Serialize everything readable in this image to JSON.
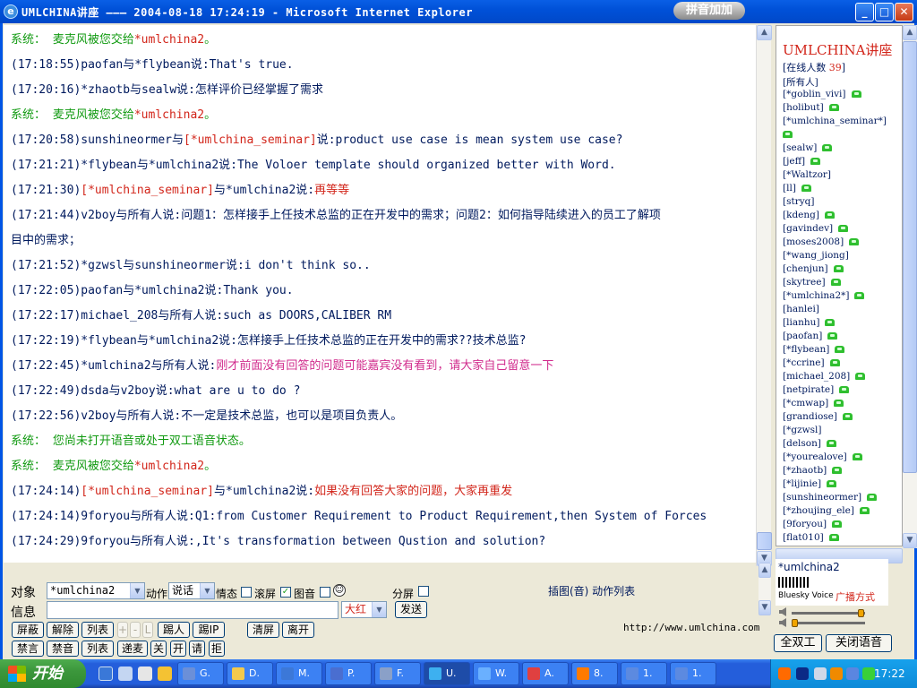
{
  "window": {
    "title": "UMLCHINA讲座 ——— 2004-08-18 17:24:19 - Microsoft Internet Explorer",
    "ime_badge": "拼音加加",
    "buttons": {
      "minimize": "_",
      "maximize": "□",
      "close": "✕"
    }
  },
  "chat": {
    "lines": [
      [
        {
          "t": "系统： ",
          "c": "green"
        },
        {
          "t": "麦克风被您交给",
          "c": "green"
        },
        {
          "t": "*umlchina2",
          "c": "red"
        },
        {
          "t": "。",
          "c": "green"
        }
      ],
      [
        {
          "t": "(17:18:55)paofan与*flybean说:That's true.",
          "c": "navy"
        }
      ],
      [
        {
          "t": "(17:20:16)*zhaotb与sealw说:怎样评价已经掌握了需求",
          "c": "navy"
        }
      ],
      [
        {
          "t": "系统： ",
          "c": "green"
        },
        {
          "t": "麦克风被您交给",
          "c": "green"
        },
        {
          "t": "*umlchina2",
          "c": "red"
        },
        {
          "t": "。",
          "c": "green"
        }
      ],
      [
        {
          "t": "(17:20:58)sunshineormer与",
          "c": "navy"
        },
        {
          "t": "[*umlchina_seminar]",
          "c": "red"
        },
        {
          "t": "说:product use case is mean system use case?",
          "c": "navy"
        }
      ],
      [
        {
          "t": "(17:21:21)*flybean与*umlchina2说:The Voloer template should organized better with Word.",
          "c": "navy"
        }
      ],
      [
        {
          "t": "(17:21:30)",
          "c": "navy"
        },
        {
          "t": "[*umlchina_seminar]",
          "c": "red"
        },
        {
          "t": "与*umlchina2说:",
          "c": "navy"
        },
        {
          "t": "再等等",
          "c": "red"
        }
      ],
      [
        {
          "t": "(17:21:44)v2boy与所有人说:问题1：怎样接手上任技术总监的正在开发中的需求；问题2：如何指导陆续进入的员工了解项",
          "c": "navy"
        }
      ],
      [
        {
          "t": "目中的需求；",
          "c": "navy"
        }
      ],
      [
        {
          "t": "(17:21:52)*gzwsl与sunshineormer说:i don't think so..",
          "c": "navy"
        }
      ],
      [
        {
          "t": "(17:22:05)paofan与*umlchina2说:Thank you.",
          "c": "navy"
        }
      ],
      [
        {
          "t": "(17:22:17)michael_208与所有人说:such as DOORS,CALIBER RM",
          "c": "navy"
        }
      ],
      [
        {
          "t": "(17:22:19)*flybean与*umlchina2说:怎样接手上任技术总监的正在开发中的需求??技术总监?",
          "c": "navy"
        }
      ],
      [
        {
          "t": "(17:22:45)*umlchina2与所有人说:",
          "c": "navy"
        },
        {
          "t": "刚才前面没有回答的问题可能嘉宾没有看到，请大家自己留意一下",
          "c": "magenta"
        }
      ],
      [
        {
          "t": "(17:22:49)dsda与v2boy说:what are u to do ?",
          "c": "navy"
        }
      ],
      [
        {
          "t": "(17:22:56)v2boy与所有人说:不一定是技术总监，也可以是项目负责人。",
          "c": "navy"
        }
      ],
      [
        {
          "t": "系统： ",
          "c": "green"
        },
        {
          "t": "您尚未打开语音或处于双工语音状态。",
          "c": "green"
        }
      ],
      [
        {
          "t": "系统： ",
          "c": "green"
        },
        {
          "t": "麦克风被您交给",
          "c": "green"
        },
        {
          "t": "*umlchina2",
          "c": "red"
        },
        {
          "t": "。",
          "c": "green"
        }
      ],
      [
        {
          "t": "(17:24:14)",
          "c": "navy"
        },
        {
          "t": "[*umlchina_seminar]",
          "c": "red"
        },
        {
          "t": "与*umlchina2说:",
          "c": "navy"
        },
        {
          "t": "如果没有回答大家的问题，大家再重发",
          "c": "red"
        }
      ],
      [
        {
          "t": "(17:24:14)9foryou与所有人说:Q1:from Customer Requirement to Product Requirement,then System of Forces",
          "c": "navy"
        }
      ],
      [
        {
          "t": "(17:24:29)9foryou与所有人说:,It's transformation between Qustion and solution?",
          "c": "navy"
        }
      ]
    ]
  },
  "userlist": {
    "title": "UMLCHINA讲座",
    "online_prefix": "[在线人数 ",
    "online_count": "39",
    "online_suffix": "]",
    "users": [
      {
        "name": "[所有人]",
        "phone": false
      },
      {
        "name": "[*goblin_vivi]",
        "phone": true
      },
      {
        "name": "[holibut]",
        "phone": true
      },
      {
        "name": "[*umlchina_seminar*]",
        "phone": false
      },
      {
        "name": "",
        "phone": true
      },
      {
        "name": "[sealw]",
        "phone": true
      },
      {
        "name": "[jeff]",
        "phone": true
      },
      {
        "name": "[*Waltzor]",
        "phone": false
      },
      {
        "name": "[ll]",
        "phone": true
      },
      {
        "name": "[stryq]",
        "phone": false
      },
      {
        "name": "[kdeng]",
        "phone": true
      },
      {
        "name": "[gavindev]",
        "phone": true
      },
      {
        "name": "[moses2008]",
        "phone": true
      },
      {
        "name": "[*wang_jiong]",
        "phone": false
      },
      {
        "name": "[chenjun]",
        "phone": true
      },
      {
        "name": "[skytree]",
        "phone": true
      },
      {
        "name": "[*umlchina2*]",
        "phone": true
      },
      {
        "name": "[hanlei]",
        "phone": false
      },
      {
        "name": "[lianhu]",
        "phone": true
      },
      {
        "name": "[paofan]",
        "phone": true
      },
      {
        "name": "[*flybean]",
        "phone": true
      },
      {
        "name": "[*ccrine]",
        "phone": true
      },
      {
        "name": "[michael_208]",
        "phone": true
      },
      {
        "name": "[netpirate]",
        "phone": true
      },
      {
        "name": "[*cmwap]",
        "phone": true
      },
      {
        "name": "[grandiose]",
        "phone": true
      },
      {
        "name": "[*gzwsl]",
        "phone": false
      },
      {
        "name": "[delson]",
        "phone": true
      },
      {
        "name": "[*yourealove]",
        "phone": true
      },
      {
        "name": "[*zhaotb]",
        "phone": true
      },
      {
        "name": "[*lijinie]",
        "phone": true
      },
      {
        "name": "[sunshineormer]",
        "phone": true
      },
      {
        "name": "[*zhoujing_ele]",
        "phone": true
      },
      {
        "name": "[9foryou]",
        "phone": true
      },
      {
        "name": "[flat010]",
        "phone": true
      }
    ]
  },
  "voice": {
    "current_speaker": "*umlchina2",
    "brand": "Bluesky Voice",
    "mode": "广播方式",
    "duplex_button": "全双工",
    "close_voice_button": "关闭语音"
  },
  "controls": {
    "target_label": "对象",
    "target_value": "*umlchina2",
    "action_label": "动作",
    "action_value": "说话",
    "emotion_label": "情态",
    "scroll_label": "滚屏",
    "scroll_checked": false,
    "image_label": "图音",
    "image_checked": true,
    "smiley": "☺",
    "split_label": "分屏",
    "split_checked": false,
    "message_label": "信息",
    "message_value": "",
    "font_value": "大红",
    "send_button": "发送",
    "media_link": "插图(音) 动作列表",
    "site_url": "http://www.umlchina.com",
    "row1": [
      "屏蔽",
      "解除",
      "列表",
      "+",
      "-",
      "L",
      "踢人",
      "踢IP",
      "清屏",
      "离开"
    ],
    "row2": [
      "禁言",
      "禁音",
      "列表",
      "递麦",
      "关",
      "开",
      "请",
      "拒"
    ]
  },
  "taskbar": {
    "start": "开始",
    "tasks": [
      "G.",
      "D.",
      "M.",
      "P.",
      "F.",
      "U.",
      "W.",
      "A.",
      "8.",
      "1.",
      "1."
    ],
    "active_task": 5,
    "clock": "17:22"
  }
}
